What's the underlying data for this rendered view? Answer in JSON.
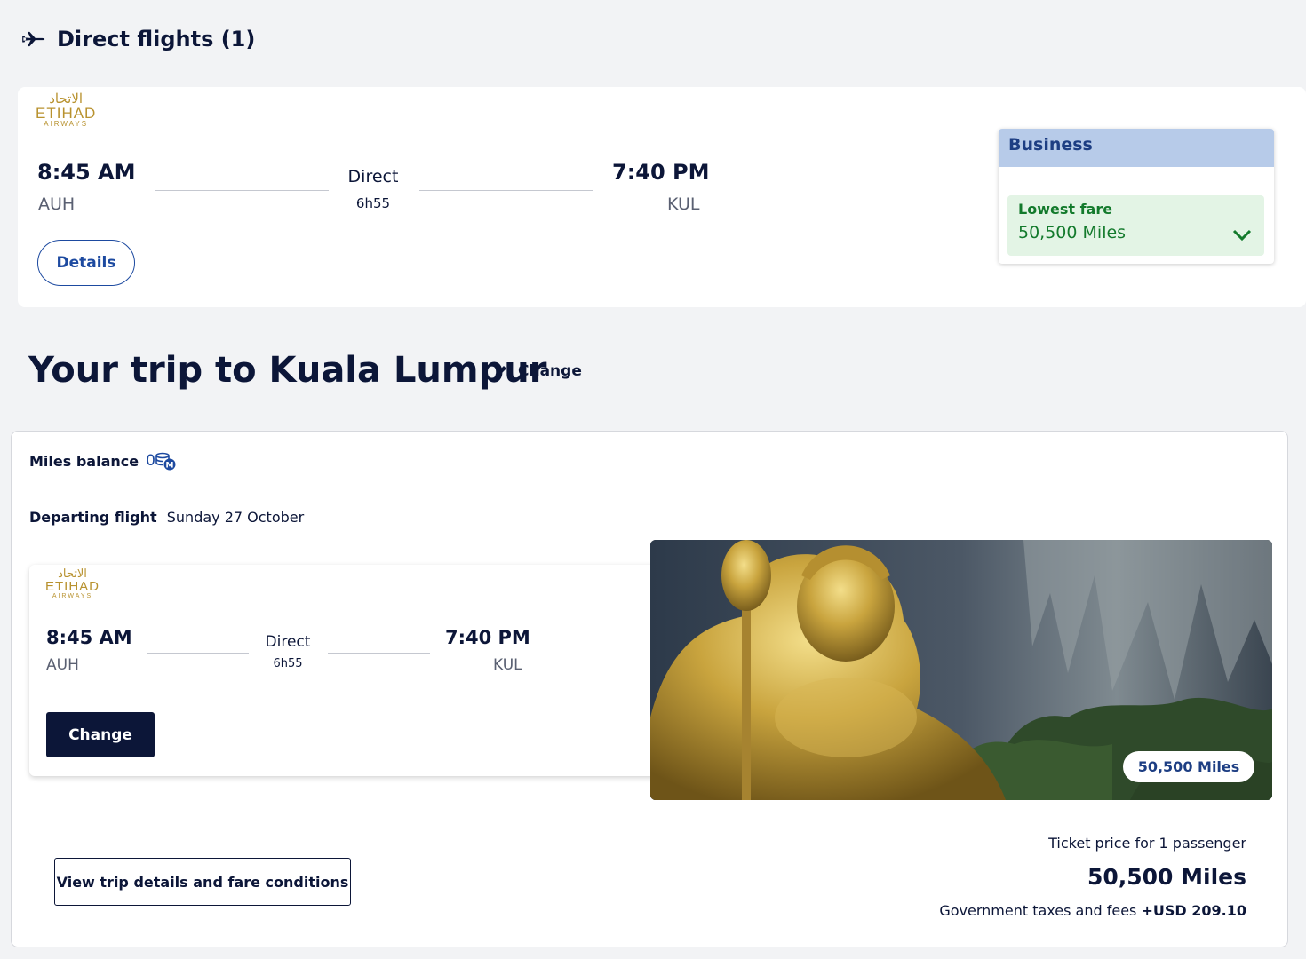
{
  "section": {
    "title": "Direct flights (1)",
    "icon": "plane-icon"
  },
  "flight": {
    "airline_logo": {
      "arabic": "الاتحاد",
      "name": "ETIHAD",
      "sub": "AIRWAYS"
    },
    "depart_time": "8:45 AM",
    "depart_code": "AUH",
    "arrive_time": "7:40 PM",
    "arrive_code": "KUL",
    "stops": "Direct",
    "duration": "6h55",
    "details_label": "Details"
  },
  "fare": {
    "cabin": "Business",
    "lowest_label": "Lowest fare",
    "lowest_value": "50,500 Miles",
    "colors": {
      "header": "#b7cbe9",
      "green": "#137a2c"
    }
  },
  "trip": {
    "title": "Your trip to Kuala Lumpur",
    "change_label": "Change",
    "miles_balance_label": "Miles balance",
    "miles_balance_value": "0",
    "departing_label": "Departing flight",
    "departing_date": "Sunday 27 October",
    "card": {
      "depart_time": "8:45 AM",
      "depart_code": "AUH",
      "arrive_time": "7:40 PM",
      "arrive_code": "KUL",
      "stops": "Direct",
      "duration": "6h55",
      "change_label": "Change"
    },
    "photo_miles": "50,500 Miles",
    "view_details_label": "View trip details and fare conditions",
    "ticket_price_label": "Ticket price for 1 passenger",
    "ticket_price_value": "50,500 Miles",
    "taxes_label": "Government taxes and fees",
    "taxes_value": "+USD 209.10"
  }
}
